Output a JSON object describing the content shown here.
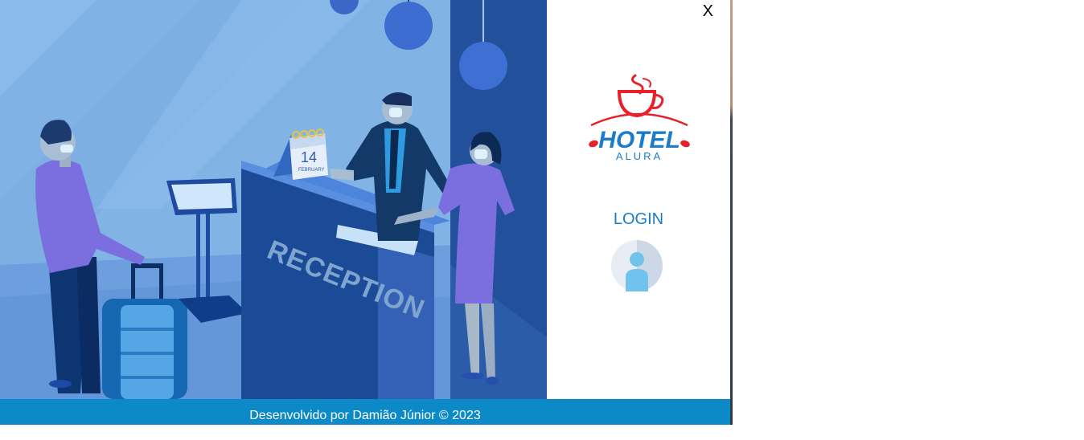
{
  "window": {
    "close_label": "X"
  },
  "hero": {
    "illustration": "hotel-reception-illustration",
    "desk_sign": "RECEPTION",
    "calendar_day": "14",
    "calendar_month": "FEBRUARY"
  },
  "brand": {
    "logo_text": "HOTEL",
    "logo_subtext": "ALURA",
    "logo_color": "#e8202a",
    "text_color": "#1b7dc9"
  },
  "login": {
    "label": "LOGIN",
    "icon": "user-icon"
  },
  "footer": {
    "text": "Desenvolvido por Damião Júnior © 2023",
    "color": "#0b8ac7"
  }
}
